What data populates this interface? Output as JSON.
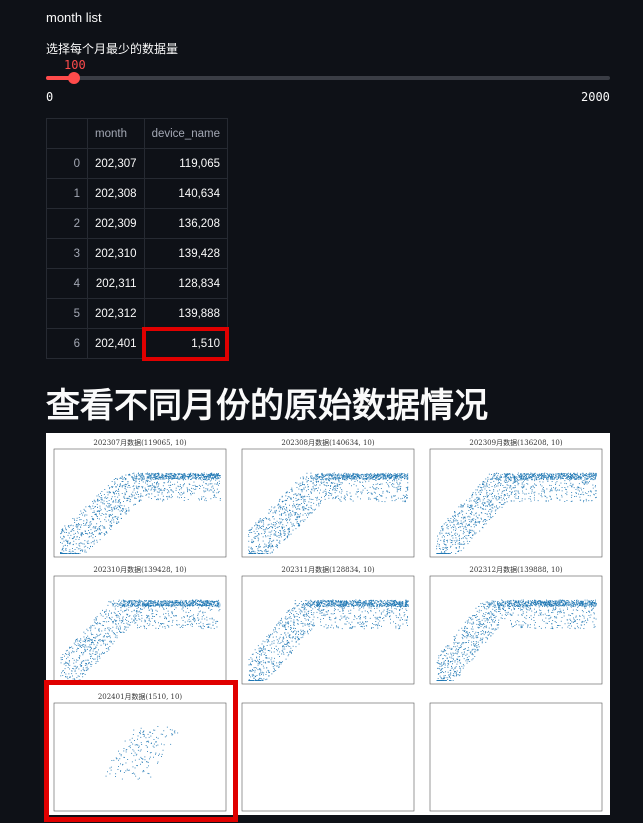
{
  "section_label": "month list",
  "slider": {
    "label": "选择每个月最少的数据量",
    "value": "100",
    "min": "0",
    "max": "2000",
    "fraction": 0.05
  },
  "table": {
    "columns": [
      "",
      "month",
      "device_name"
    ],
    "rows": [
      [
        "0",
        "202,307",
        "119,065"
      ],
      [
        "1",
        "202,308",
        "140,634"
      ],
      [
        "2",
        "202,309",
        "136,208"
      ],
      [
        "3",
        "202,310",
        "139,428"
      ],
      [
        "4",
        "202,311",
        "128,834"
      ],
      [
        "5",
        "202,312",
        "139,888"
      ],
      [
        "6",
        "202,401",
        "1,510"
      ]
    ]
  },
  "heading": "查看不同月份的原始数据情况",
  "plots": [
    {
      "title": "202307月数据(119065, 10)"
    },
    {
      "title": "202308月数据(140634, 10)"
    },
    {
      "title": "202309月数据(136208, 10)"
    },
    {
      "title": "202310月数据(139428, 10)"
    },
    {
      "title": "202311月数据(128834, 10)"
    },
    {
      "title": "202312月数据(139888, 10)"
    },
    {
      "title": "202401月数据(1510, 10)"
    },
    {
      "title": ""
    },
    {
      "title": ""
    }
  ],
  "colors": {
    "accent": "#ff4b4b",
    "highlight": "#e00000",
    "scatter": "#1f77b4"
  }
}
